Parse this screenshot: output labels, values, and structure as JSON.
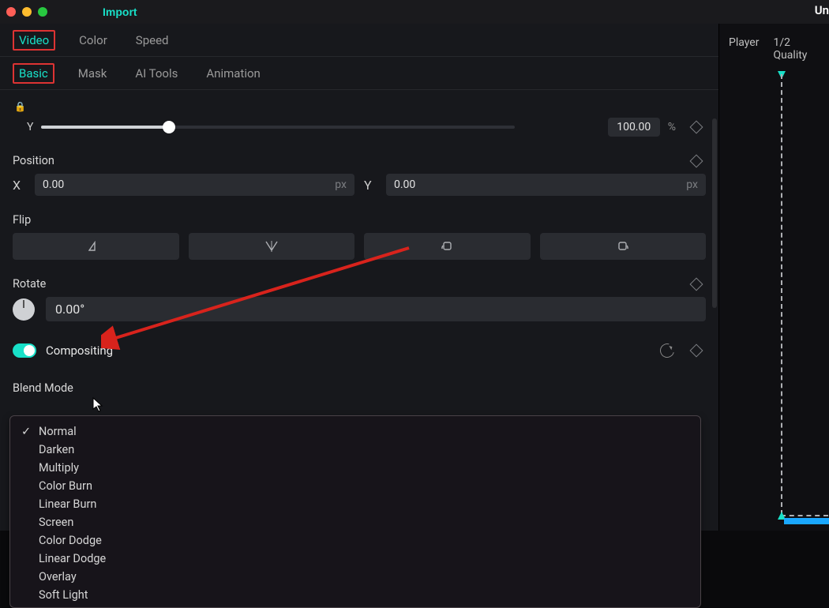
{
  "top": {
    "import_label": "Import",
    "title_partial": "Un"
  },
  "player": {
    "tab1": "Player",
    "quality": "1/2 Quality"
  },
  "primary_tabs": {
    "video": "Video",
    "color": "Color",
    "speed": "Speed"
  },
  "secondary_tabs": {
    "basic": "Basic",
    "mask": "Mask",
    "ai": "AI Tools",
    "anim": "Animation"
  },
  "scale": {
    "axis": "Y",
    "value": "100.00",
    "unit": "%"
  },
  "position": {
    "header": "Position",
    "x_label": "X",
    "x_value": "0.00",
    "x_suffix": "px",
    "y_label": "Y",
    "y_value": "0.00",
    "y_suffix": "px"
  },
  "flip": {
    "header": "Flip"
  },
  "rotate": {
    "header": "Rotate",
    "value": "0.00°"
  },
  "compositing": {
    "label": "Compositing"
  },
  "blend": {
    "header": "Blend Mode",
    "options": [
      "Normal",
      "Darken",
      "Multiply",
      "Color Burn",
      "Linear Burn",
      "Screen",
      "Color Dodge",
      "Linear Dodge",
      "Overlay",
      "Soft Light"
    ],
    "selected_index": 0
  },
  "colors": {
    "accent": "#18e0c8",
    "highlight_box": "#d33"
  }
}
